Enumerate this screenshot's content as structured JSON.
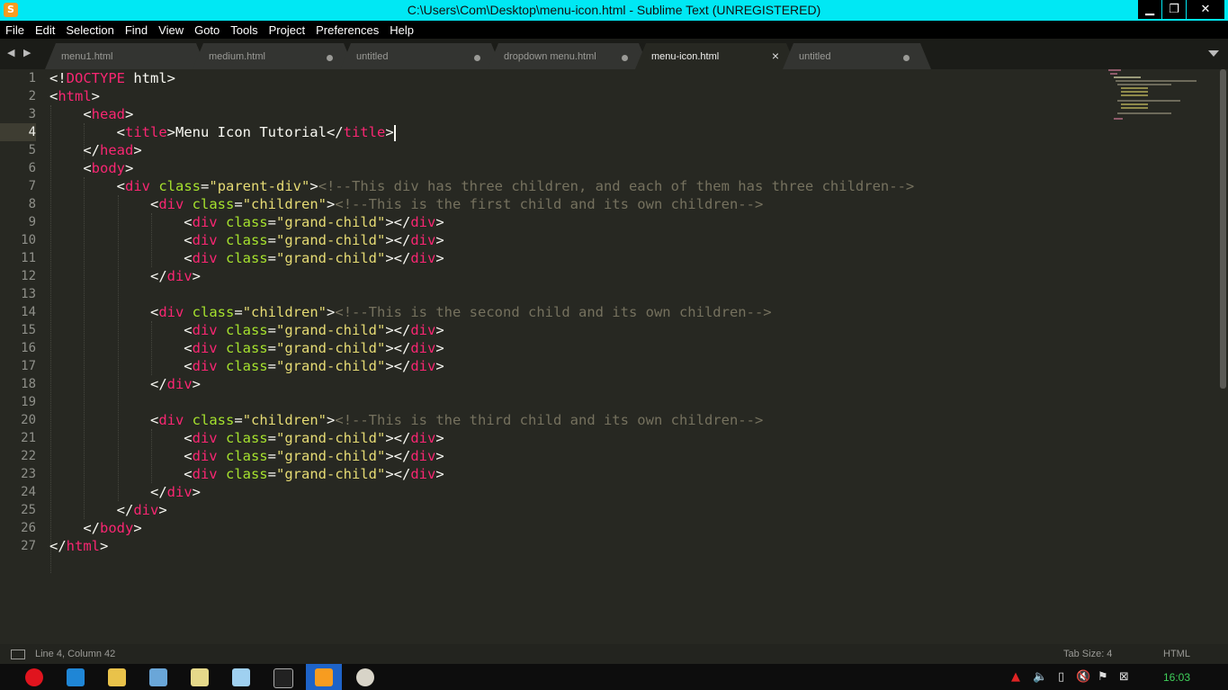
{
  "window": {
    "title": "C:\\Users\\Com\\Desktop\\menu-icon.html - Sublime Text (UNREGISTERED)",
    "app_icon_letter": "S",
    "controls": {
      "minimize": "▁",
      "maximize": "❐",
      "close": "✕"
    }
  },
  "menu": [
    "File",
    "Edit",
    "Selection",
    "Find",
    "View",
    "Goto",
    "Tools",
    "Project",
    "Preferences",
    "Help"
  ],
  "tab_nav": "◀ ▶",
  "tabs": [
    {
      "label": "menu1.html",
      "modified": false,
      "active": false
    },
    {
      "label": "medium.html",
      "modified": true,
      "active": false
    },
    {
      "label": "untitled",
      "modified": true,
      "active": false
    },
    {
      "label": "dropdown menu.html",
      "modified": true,
      "active": false
    },
    {
      "label": "menu-icon.html",
      "modified": false,
      "active": true,
      "close": "×"
    },
    {
      "label": "untitled",
      "modified": true,
      "active": false
    }
  ],
  "editor": {
    "current_line": 4,
    "lines": [
      [
        [
          "p",
          "<!"
        ],
        [
          "t",
          "DOCTYPE"
        ],
        [
          "p",
          " html>"
        ]
      ],
      [
        [
          "p",
          "<"
        ],
        [
          "t",
          "html"
        ],
        [
          "p",
          ">"
        ]
      ],
      [
        [
          "p",
          "    <"
        ],
        [
          "t",
          "head"
        ],
        [
          "p",
          ">"
        ]
      ],
      [
        [
          "p",
          "        <"
        ],
        [
          "t",
          "title"
        ],
        [
          "p",
          ">Menu Icon Tutorial</"
        ],
        [
          "t",
          "title"
        ],
        [
          "p",
          ">"
        ]
      ],
      [
        [
          "p",
          "    </"
        ],
        [
          "t",
          "head"
        ],
        [
          "p",
          ">"
        ]
      ],
      [
        [
          "p",
          "    <"
        ],
        [
          "t",
          "body"
        ],
        [
          "p",
          ">"
        ]
      ],
      [
        [
          "p",
          "        <"
        ],
        [
          "t",
          "div"
        ],
        [
          "p",
          " "
        ],
        [
          "a",
          "class"
        ],
        [
          "p",
          "="
        ],
        [
          "s",
          "\"parent-div\""
        ],
        [
          "p",
          ">"
        ],
        [
          "c",
          "<!--This div has three children, and each of them has three children-->"
        ]
      ],
      [
        [
          "p",
          "            <"
        ],
        [
          "t",
          "div"
        ],
        [
          "p",
          " "
        ],
        [
          "a",
          "class"
        ],
        [
          "p",
          "="
        ],
        [
          "s",
          "\"children\""
        ],
        [
          "p",
          ">"
        ],
        [
          "c",
          "<!--This is the first child and its own children-->"
        ]
      ],
      [
        [
          "p",
          "                <"
        ],
        [
          "t",
          "div"
        ],
        [
          "p",
          " "
        ],
        [
          "a",
          "class"
        ],
        [
          "p",
          "="
        ],
        [
          "s",
          "\"grand-child\""
        ],
        [
          "p",
          "></"
        ],
        [
          "t",
          "div"
        ],
        [
          "p",
          ">"
        ]
      ],
      [
        [
          "p",
          "                <"
        ],
        [
          "t",
          "div"
        ],
        [
          "p",
          " "
        ],
        [
          "a",
          "class"
        ],
        [
          "p",
          "="
        ],
        [
          "s",
          "\"grand-child\""
        ],
        [
          "p",
          "></"
        ],
        [
          "t",
          "div"
        ],
        [
          "p",
          ">"
        ]
      ],
      [
        [
          "p",
          "                <"
        ],
        [
          "t",
          "div"
        ],
        [
          "p",
          " "
        ],
        [
          "a",
          "class"
        ],
        [
          "p",
          "="
        ],
        [
          "s",
          "\"grand-child\""
        ],
        [
          "p",
          "></"
        ],
        [
          "t",
          "div"
        ],
        [
          "p",
          ">"
        ]
      ],
      [
        [
          "p",
          "            </"
        ],
        [
          "t",
          "div"
        ],
        [
          "p",
          ">"
        ]
      ],
      [],
      [
        [
          "p",
          "            <"
        ],
        [
          "t",
          "div"
        ],
        [
          "p",
          " "
        ],
        [
          "a",
          "class"
        ],
        [
          "p",
          "="
        ],
        [
          "s",
          "\"children\""
        ],
        [
          "p",
          ">"
        ],
        [
          "c",
          "<!--This is the second child and its own children-->"
        ]
      ],
      [
        [
          "p",
          "                <"
        ],
        [
          "t",
          "div"
        ],
        [
          "p",
          " "
        ],
        [
          "a",
          "class"
        ],
        [
          "p",
          "="
        ],
        [
          "s",
          "\"grand-child\""
        ],
        [
          "p",
          "></"
        ],
        [
          "t",
          "div"
        ],
        [
          "p",
          ">"
        ]
      ],
      [
        [
          "p",
          "                <"
        ],
        [
          "t",
          "div"
        ],
        [
          "p",
          " "
        ],
        [
          "a",
          "class"
        ],
        [
          "p",
          "="
        ],
        [
          "s",
          "\"grand-child\""
        ],
        [
          "p",
          "></"
        ],
        [
          "t",
          "div"
        ],
        [
          "p",
          ">"
        ]
      ],
      [
        [
          "p",
          "                <"
        ],
        [
          "t",
          "div"
        ],
        [
          "p",
          " "
        ],
        [
          "a",
          "class"
        ],
        [
          "p",
          "="
        ],
        [
          "s",
          "\"grand-child\""
        ],
        [
          "p",
          "></"
        ],
        [
          "t",
          "div"
        ],
        [
          "p",
          ">"
        ]
      ],
      [
        [
          "p",
          "            </"
        ],
        [
          "t",
          "div"
        ],
        [
          "p",
          ">"
        ]
      ],
      [],
      [
        [
          "p",
          "            <"
        ],
        [
          "t",
          "div"
        ],
        [
          "p",
          " "
        ],
        [
          "a",
          "class"
        ],
        [
          "p",
          "="
        ],
        [
          "s",
          "\"children\""
        ],
        [
          "p",
          ">"
        ],
        [
          "c",
          "<!--This is the third child and its own children-->"
        ]
      ],
      [
        [
          "p",
          "                <"
        ],
        [
          "t",
          "div"
        ],
        [
          "p",
          " "
        ],
        [
          "a",
          "class"
        ],
        [
          "p",
          "="
        ],
        [
          "s",
          "\"grand-child\""
        ],
        [
          "p",
          "></"
        ],
        [
          "t",
          "div"
        ],
        [
          "p",
          ">"
        ]
      ],
      [
        [
          "p",
          "                <"
        ],
        [
          "t",
          "div"
        ],
        [
          "p",
          " "
        ],
        [
          "a",
          "class"
        ],
        [
          "p",
          "="
        ],
        [
          "s",
          "\"grand-child\""
        ],
        [
          "p",
          "></"
        ],
        [
          "t",
          "div"
        ],
        [
          "p",
          ">"
        ]
      ],
      [
        [
          "p",
          "                <"
        ],
        [
          "t",
          "div"
        ],
        [
          "p",
          " "
        ],
        [
          "a",
          "class"
        ],
        [
          "p",
          "="
        ],
        [
          "s",
          "\"grand-child\""
        ],
        [
          "p",
          "></"
        ],
        [
          "t",
          "div"
        ],
        [
          "p",
          ">"
        ]
      ],
      [
        [
          "p",
          "            </"
        ],
        [
          "t",
          "div"
        ],
        [
          "p",
          ">"
        ]
      ],
      [
        [
          "p",
          "        </"
        ],
        [
          "t",
          "div"
        ],
        [
          "p",
          ">"
        ]
      ],
      [
        [
          "p",
          "    </"
        ],
        [
          "t",
          "body"
        ],
        [
          "p",
          ">"
        ]
      ],
      [
        [
          "p",
          "</"
        ],
        [
          "t",
          "html"
        ],
        [
          "p",
          ">"
        ]
      ]
    ]
  },
  "status": {
    "position": "Line 4, Column 42",
    "tab_size": "Tab Size: 4",
    "syntax": "HTML"
  },
  "taskbar": {
    "apps": [
      "opera-icon",
      "vscode-icon",
      "file-explorer-icon",
      "computer-icon",
      "folder-files-icon",
      "notepad-icon",
      "cmd-icon",
      "sublime-icon",
      "paint-icon"
    ],
    "clock": "16:03"
  },
  "colors": {
    "titlebar": "#00e8f4",
    "editor_bg": "#272822",
    "tag": "#f92672",
    "attribute": "#a6e22e",
    "string": "#e6db74",
    "comment": "#75715e"
  }
}
